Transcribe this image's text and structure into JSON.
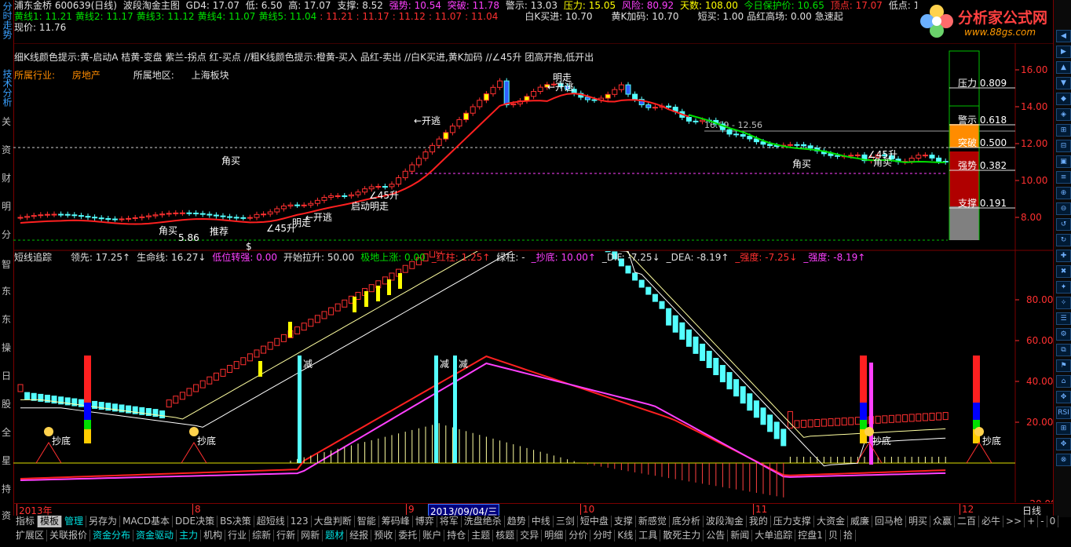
{
  "header": {
    "stock": "浦东金桥 600639(日线)",
    "indicator": "波段淘金主图",
    "gd4": "GD4: 17.07",
    "low": "低: 6.50",
    "high": "高: 17.07",
    "support": "支撑: 8.52",
    "strong": "强势: 10.54",
    "breakout": "突破: 11.78",
    "warning": "警示: 13.03",
    "pressure": "压力: 15.05",
    "risk": "风险: 80.92",
    "days": "天数: 108.00",
    "today_protect": "今日保护价: 10.65",
    "top_point": "顶点: 17.07",
    "low_point": "低点: 10.30",
    "lines": [
      "黄线1: 11.21",
      "黄线2: 11.17",
      "黄线3: 11.12",
      "黄线4: 11.07",
      "黄线5: 11.04"
    ],
    "reds": [
      ": 11.21",
      ": 11.17",
      ": 11.12",
      ": 11.07",
      ": 11.04"
    ],
    "white_k_in": "白K买进: 10.70",
    "yellow_k_add": "黄K加码: 10.70",
    "short_buy": "短买: 1.00",
    "product_red_high": "品红高场: 0.00",
    "quick_up": "急速起",
    "current_price": "现价: 11.76",
    "hint": "细K线颜色提示:黄-启动A  桔黄-变盘  紫兰-拐点  红-买点  //粗K线颜色提示:橙黄-买入  品红-卖出  //白K买进,黄K加码  //∠45升 团高开抱,低开出",
    "industry_label": "所属行业:",
    "industry": "房地产",
    "region_label": "所属地区:",
    "region": "上海板块"
  },
  "logo": {
    "title": "分析家公式网",
    "url": "www.88gs.com"
  },
  "left_tabs": [
    "分时走势",
    "技术分析",
    "关",
    "资",
    "财",
    "明",
    "分",
    "智",
    "东",
    "东",
    "操",
    "日",
    "股",
    "全",
    "星",
    "持",
    "资"
  ],
  "main_chart": {
    "right_labels": [
      {
        "text": "压力 0.809",
        "color": "#ffffff"
      },
      {
        "text": "警示 0.618",
        "color": "#ffffff"
      },
      {
        "text": "突破 0.500",
        "color": "#ffffff"
      },
      {
        "text": "强势 0.382",
        "color": "#ffffff"
      },
      {
        "text": "支撑 0.191",
        "color": "#ffffff"
      }
    ],
    "price_axis": [
      "16.00",
      "14.00",
      "12.00",
      "10.00",
      "8.00"
    ],
    "range_label": "16.69 - 12.56",
    "annotations": [
      "←开逃",
      "明走",
      "←开逃",
      "∠45升",
      "启动明走",
      "←开逃",
      "明走",
      "角买",
      "角买",
      "角买",
      "角买",
      "∠45升",
      "∠45升",
      "推荐",
      "5.86",
      "$"
    ]
  },
  "sub_chart": {
    "title": "短线追踪",
    "stats": [
      {
        "text": "领先: 17.25↑",
        "color": "#e0e0e0"
      },
      {
        "text": "生命线: 16.27↓",
        "color": "#e0e0e0"
      },
      {
        "text": "低位转强: 0.00",
        "color": "#ff40ff"
      },
      {
        "text": "开始拉升: 50.00",
        "color": "#e0e0e0"
      },
      {
        "text": "极地上涨: 0.00",
        "color": "#00e000"
      },
      {
        "text": "_红柱: 1.25↑",
        "color": "#ff3030"
      },
      {
        "text": "绿柱: -",
        "color": "#e0e0e0"
      },
      {
        "text": "_抄底: 10.00↑",
        "color": "#ff40ff"
      },
      {
        "text": "_DIF: -7.25↓",
        "color": "#e0e0e0"
      },
      {
        "text": "_DEA: -8.19↑",
        "color": "#e0e0e0"
      },
      {
        "text": "_强度: -7.25↓",
        "color": "#ff3030"
      },
      {
        "text": "_强度: -8.19↑",
        "color": "#ff40ff"
      }
    ],
    "axis": [
      "80.00",
      "60.00",
      "40.00",
      "20.00",
      "-20.00"
    ],
    "annotations": [
      "减",
      "减",
      "减",
      "抄底",
      "抄底",
      "抄底",
      "抄底"
    ]
  },
  "date_axis": {
    "labels": [
      "2013年",
      "8",
      "9",
      "10",
      "11",
      "12"
    ],
    "cursor": "2013/09/04/三",
    "period": "日线"
  },
  "tabs_row1": [
    "指标",
    "模板",
    "管理",
    "另存为",
    "MACD基本",
    "DDE决策",
    "BS决策",
    "超短线",
    "123",
    "大盘判断",
    "智能",
    "筹码峰",
    "博弈",
    "将军",
    "洗盘绝杀",
    "趋势",
    "中线",
    "三剑",
    "短中盘",
    "支撑",
    "新感觉",
    "底分析",
    "波段淘金",
    "我的",
    "压力支撑",
    "大资金",
    "威廉",
    "回马枪",
    "明买",
    "众赢",
    "二百",
    "必牛"
  ],
  "tabs_row1_right": [
    ">>",
    "+",
    "-",
    "0"
  ],
  "tabs_row2": [
    "扩展区",
    "关联报价",
    "资金分布",
    "资金驱动",
    "主力",
    "机构",
    "行业",
    "综新",
    "行新",
    "网新",
    "题材",
    "经报",
    "预收",
    "委托",
    "账户",
    "持仓",
    "主题",
    "核题",
    "交异",
    "明细",
    "分价",
    "分时",
    "K线",
    "工具",
    "散死主力",
    "公告",
    "新闻",
    "大单追踪",
    "控盘1"
  ],
  "tabs_row2_right": [
    "拾",
    "贝"
  ],
  "colors": {
    "up": "#ff3030",
    "down": "#54ffff",
    "ma_red": "#ff2020",
    "ma_green": "#00e000",
    "grid": "#7a0000"
  }
}
